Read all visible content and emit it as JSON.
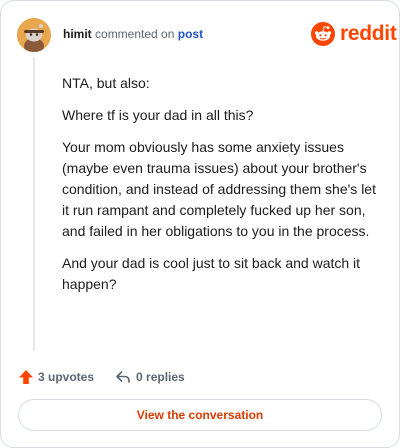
{
  "comment": {
    "username": "himit",
    "action_text": "commented on",
    "target_link": "post",
    "paragraphs": [
      "NTA, but also:",
      "Where tf is your dad in all this?",
      "Your mom obviously has some anxiety issues (maybe even trauma issues) about your brother's condition, and instead of addressing them she's let it run rampant and completely fucked up her son, and failed in her obligations to you in the process.",
      "And your dad is cool just to sit back and watch it happen?"
    ]
  },
  "brand": {
    "wordmark": "reddit",
    "color": "#ff4500"
  },
  "footer": {
    "upvotes": "3 upvotes",
    "replies": "0 replies",
    "cta_label": "View the conversation"
  },
  "icons": {
    "upvote": "upvote-arrow-icon",
    "reply": "reply-arrow-icon",
    "logo": "reddit-snoo-icon"
  },
  "colors": {
    "accent": "#ff4500",
    "link": "#2253c9",
    "cta_text": "#d93a00"
  }
}
